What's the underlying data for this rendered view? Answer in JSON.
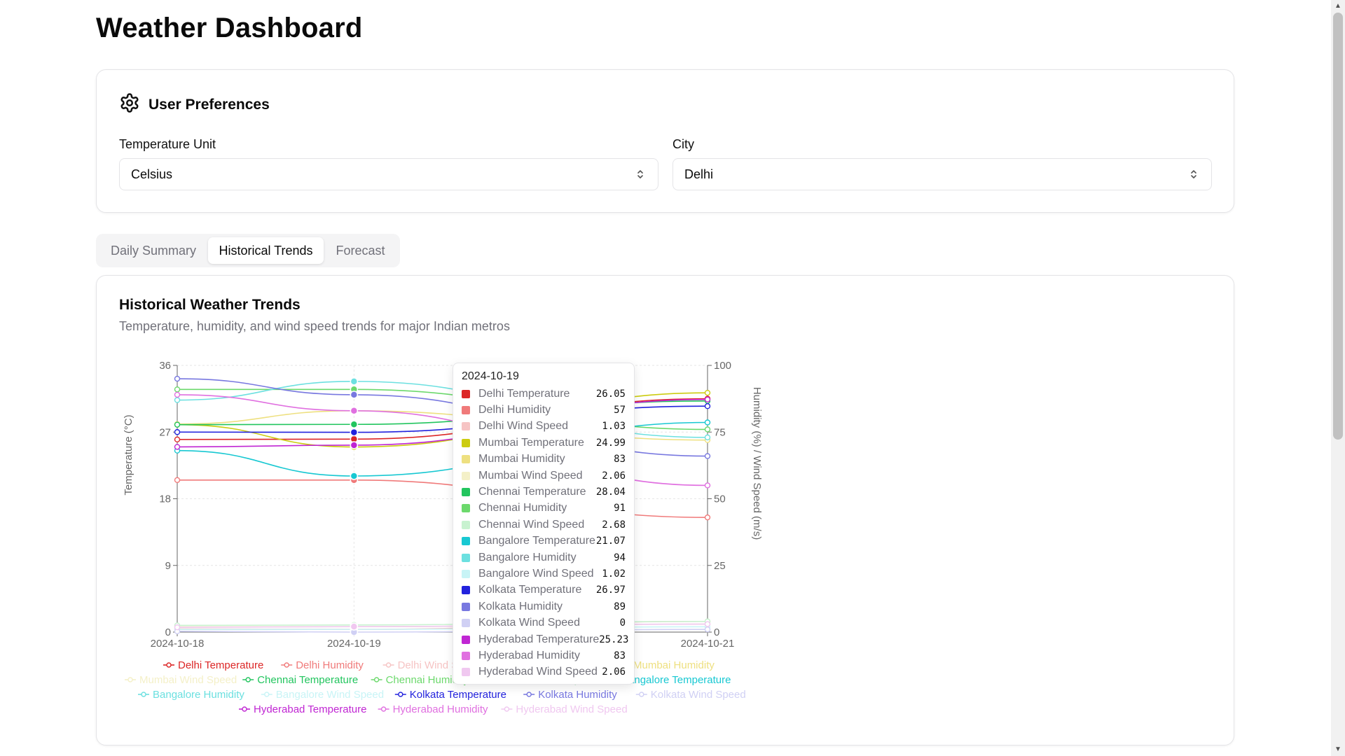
{
  "page_title": "Weather Dashboard",
  "preferences": {
    "title": "User Preferences",
    "temp_label": "Temperature Unit",
    "temp_value": "Celsius",
    "city_label": "City",
    "city_value": "Delhi"
  },
  "tabs": [
    {
      "label": "Daily Summary",
      "active": false
    },
    {
      "label": "Historical Trends",
      "active": true
    },
    {
      "label": "Forecast",
      "active": false
    }
  ],
  "chart_card": {
    "title": "Historical Weather Trends",
    "subtitle": "Temperature, humidity, and wind speed trends for major Indian metros"
  },
  "tooltip": {
    "date": "2024-10-19",
    "rows": [
      {
        "name": "Delhi Temperature",
        "value": "26.05"
      },
      {
        "name": "Delhi Humidity",
        "value": "57"
      },
      {
        "name": "Delhi Wind Speed",
        "value": "1.03"
      },
      {
        "name": "Mumbai Temperature",
        "value": "24.99"
      },
      {
        "name": "Mumbai Humidity",
        "value": "83"
      },
      {
        "name": "Mumbai Wind Speed",
        "value": "2.06"
      },
      {
        "name": "Chennai Temperature",
        "value": "28.04"
      },
      {
        "name": "Chennai Humidity",
        "value": "91"
      },
      {
        "name": "Chennai Wind Speed",
        "value": "2.68"
      },
      {
        "name": "Bangalore Temperature",
        "value": "21.07"
      },
      {
        "name": "Bangalore Humidity",
        "value": "94"
      },
      {
        "name": "Bangalore Wind Speed",
        "value": "1.02"
      },
      {
        "name": "Kolkata Temperature",
        "value": "26.97"
      },
      {
        "name": "Kolkata Humidity",
        "value": "89"
      },
      {
        "name": "Kolkata Wind Speed",
        "value": "0"
      },
      {
        "name": "Hyderabad Temperature",
        "value": "25.23"
      },
      {
        "name": "Hyderabad Humidity",
        "value": "83"
      },
      {
        "name": "Hyderabad Wind Speed",
        "value": "2.06"
      }
    ]
  },
  "chart_data": {
    "type": "line",
    "x": [
      "2024-10-18",
      "2024-10-19",
      "2024-10-21"
    ],
    "x_tick_labels": [
      "2024-10-18",
      "2024-10-19",
      "2024-10-21"
    ],
    "ylabel_left": "Temperature (°C)",
    "ylabel_right": "Humidity (%) / Wind Speed (m/s)",
    "ylim_left": [
      0,
      36
    ],
    "ylim_right": [
      0,
      100
    ],
    "yticks_left": [
      0,
      9,
      18,
      27,
      36
    ],
    "yticks_right": [
      0,
      25,
      50,
      75,
      100
    ],
    "grid": true,
    "legend_position": "bottom",
    "series": [
      {
        "name": "Delhi Temperature",
        "axis": "left",
        "color": "#dc2626",
        "values": [
          26.0,
          26.05,
          31.5
        ]
      },
      {
        "name": "Delhi Humidity",
        "axis": "right",
        "color": "#f07a7a",
        "values": [
          57,
          57,
          43
        ]
      },
      {
        "name": "Delhi Wind Speed",
        "axis": "right",
        "color": "#f6c4c4",
        "values": [
          1.2,
          1.03,
          4
        ]
      },
      {
        "name": "Mumbai Temperature",
        "axis": "left",
        "color": "#cccc10",
        "values": [
          28.0,
          24.99,
          32.3
        ]
      },
      {
        "name": "Mumbai Humidity",
        "axis": "right",
        "color": "#eee080",
        "values": [
          78,
          83,
          72
        ]
      },
      {
        "name": "Mumbai Wind Speed",
        "axis": "right",
        "color": "#f4f0c8",
        "values": [
          2.0,
          2.06,
          3.0
        ]
      },
      {
        "name": "Chennai Temperature",
        "axis": "left",
        "color": "#22c55e",
        "values": [
          28.0,
          28.04,
          31.2
        ]
      },
      {
        "name": "Chennai Humidity",
        "axis": "right",
        "color": "#6cd96c",
        "values": [
          91,
          91,
          76
        ]
      },
      {
        "name": "Chennai Wind Speed",
        "axis": "right",
        "color": "#c8f2d0",
        "values": [
          2.5,
          2.68,
          4
        ]
      },
      {
        "name": "Bangalore Temperature",
        "axis": "left",
        "color": "#18c8d2",
        "values": [
          24.5,
          21.07,
          28.3
        ]
      },
      {
        "name": "Bangalore Humidity",
        "axis": "right",
        "color": "#6ce0e0",
        "values": [
          87,
          94,
          73
        ]
      },
      {
        "name": "Bangalore Wind Speed",
        "axis": "right",
        "color": "#c8f4f6",
        "values": [
          1.0,
          1.02,
          2
        ]
      },
      {
        "name": "Kolkata Temperature",
        "axis": "left",
        "color": "#2222dd",
        "values": [
          27.0,
          26.97,
          30.5
        ]
      },
      {
        "name": "Kolkata Humidity",
        "axis": "right",
        "color": "#7878e0",
        "values": [
          95,
          89,
          66
        ]
      },
      {
        "name": "Kolkata Wind Speed",
        "axis": "right",
        "color": "#d0d0f4",
        "values": [
          0.3,
          0,
          1
        ]
      },
      {
        "name": "Hyderabad Temperature",
        "axis": "left",
        "color": "#c026d3",
        "values": [
          25.0,
          25.23,
          31.4
        ]
      },
      {
        "name": "Hyderabad Humidity",
        "axis": "right",
        "color": "#e070e0",
        "values": [
          89,
          83,
          55
        ]
      },
      {
        "name": "Hyderabad Wind Speed",
        "axis": "right",
        "color": "#f0c8f0",
        "values": [
          1.8,
          2.06,
          3
        ]
      }
    ]
  }
}
